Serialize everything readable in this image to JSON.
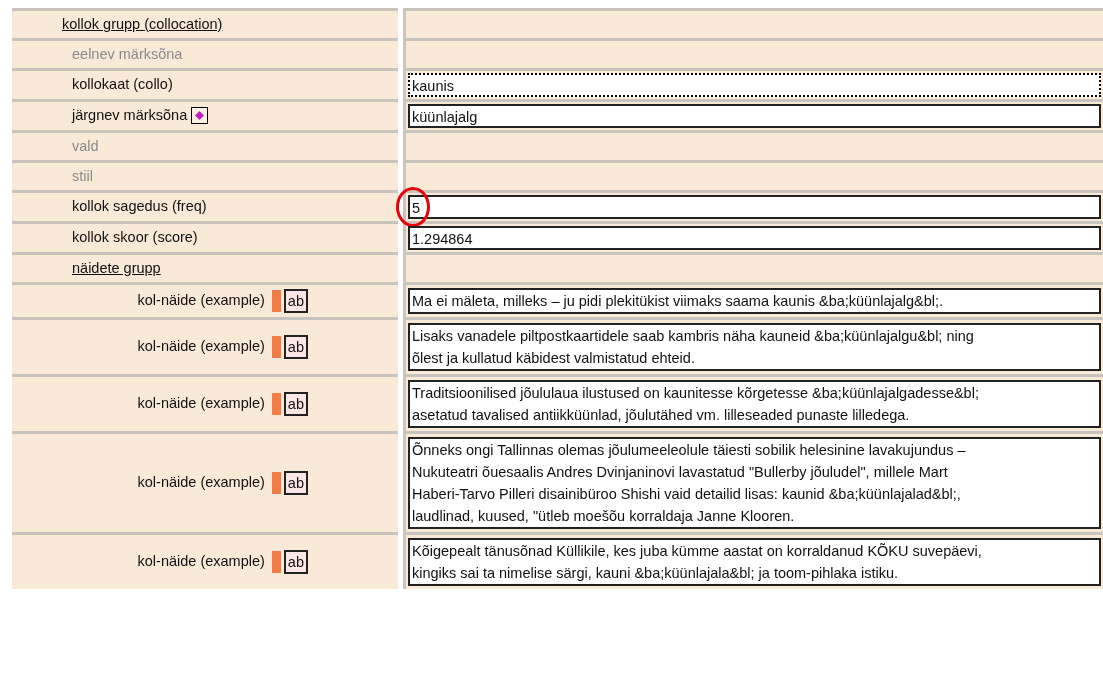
{
  "rows": [
    {
      "kind": "header",
      "label": "kollok grupp (collocation)",
      "indent": false
    },
    {
      "kind": "disabled",
      "label": "eelnev märksõna"
    },
    {
      "kind": "field",
      "label": "kollokaat (collo)",
      "value": "kaunis",
      "focused": true,
      "circled": false,
      "marker": false
    },
    {
      "kind": "field",
      "label": "järgnev märksõna",
      "value": "küünlajalg",
      "focused": false,
      "circled": false,
      "marker": true
    },
    {
      "kind": "disabled",
      "label": "vald"
    },
    {
      "kind": "disabled",
      "label": "stiil"
    },
    {
      "kind": "field",
      "label": "kollok sagedus (freq)",
      "value": "5",
      "focused": false,
      "circled": true,
      "marker": false
    },
    {
      "kind": "field",
      "label": "kollok skoor (score)",
      "value": "1.294864",
      "focused": false,
      "circled": false,
      "marker": false
    },
    {
      "kind": "header",
      "label": "näidete grupp",
      "indent": true
    },
    {
      "kind": "example",
      "label": "kol-näide (example)",
      "button": "ab",
      "value": "Ma ei mäleta, milleks – ju pidi plekitükist viimaks saama kaunis &ba;küünlajalg&bl;."
    },
    {
      "kind": "example",
      "label": "kol-näide (example)",
      "button": "ab",
      "value": "Lisaks vanadele piltpostkaartidele saab kambris näha kauneid &ba;küünlajalgu&bl; ning õlest ja kullatud käbidest valmistatud ehteid."
    },
    {
      "kind": "example",
      "label": "kol-näide (example)",
      "button": "ab",
      "value": "Traditsioonilised jõululaua ilustused on kaunitesse kõrgetesse &ba;küünlajalgadesse&bl; asetatud tavalised antiikküünlad, jõulutähed vm. lilleseaded punaste lilledega."
    },
    {
      "kind": "example",
      "label": "kol-näide (example)",
      "button": "ab",
      "value": "Õnneks ongi Tallinnas olemas jõulumeeleolule täiesti sobilik helesinine lavakujundus – Nukuteatri õuesaalis Andres Dvinjaninovi lavastatud \"Bullerby jõuludel\", millele Mart Haberi-Tarvo Pilleri disainibüroo Shishi vaid detailid lisas: kaunid &ba;küünlajalad&bl;, laudlinad, kuused, \"ütleb moešõu korraldaja Janne Klooren."
    },
    {
      "kind": "example",
      "label": "kol-näide (example)",
      "button": "ab",
      "value": "Kõigepealt tänusõnad Küllikile, kes juba kümme aastat on korraldanud KÕKU suvepäevi, kingiks sai ta nimelise särgi, kauni &ba;küünlajala&bl; ja toom-pihlaka istiku."
    }
  ]
}
